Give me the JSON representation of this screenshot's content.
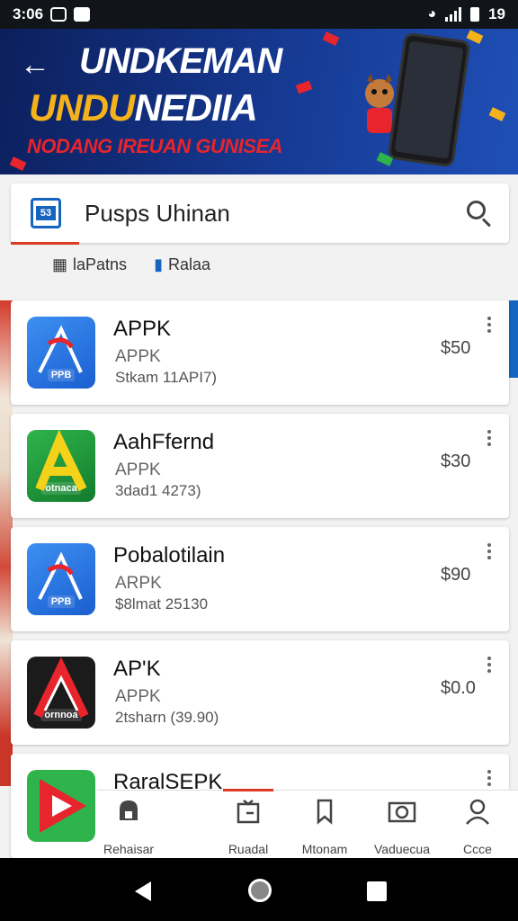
{
  "status_bar": {
    "time": "3:06",
    "right_text": "19"
  },
  "banner": {
    "line1": "UNDKEMAN",
    "line2_a": "UNDU",
    "line2_b": "NEDIIA",
    "line3": "NODANG IREUAN GUNISEA"
  },
  "search": {
    "title": "Pusps Uhinan",
    "app_badge": "53"
  },
  "filters": [
    {
      "label": "laPatns",
      "icon": "sort-icon"
    },
    {
      "label": "Ralaa",
      "icon": "bookmark-icon"
    }
  ],
  "apps": [
    {
      "name": "APPK",
      "subtitle": "APPK",
      "meta": "Stkam 11API7)",
      "price": "$50",
      "icon_label": "PPB"
    },
    {
      "name": "AahFfernd",
      "subtitle": "APPK",
      "meta": "3dad1 4273)",
      "price": "$30",
      "icon_label": "otnaca"
    },
    {
      "name": "Pobalotilain",
      "subtitle": "ARPK",
      "meta": "$8lmat 25130",
      "price": "$90",
      "icon_label": "PPB"
    },
    {
      "name": "AP'K",
      "subtitle": "APPK",
      "meta": "2tsharn (39.90)",
      "price": "$0.0",
      "icon_label": "ornnoa"
    },
    {
      "name": "RaralSEP​K",
      "subtitle": "",
      "meta": "",
      "price": "",
      "icon_label": ""
    }
  ],
  "bottom_nav": [
    {
      "label": "Rehaisar",
      "icon": "store-icon"
    },
    {
      "label": "Ruadal",
      "icon": "inbox-icon"
    },
    {
      "label": "Mtonam",
      "icon": "bookmark-icon"
    },
    {
      "label": "Vaduecua",
      "icon": "camera-icon"
    },
    {
      "label": "Ccce",
      "icon": "person-icon"
    }
  ],
  "colors": {
    "accent_red": "#d93a26",
    "accent_blue": "#1565c0",
    "banner_yellow": "#f5b21a"
  }
}
